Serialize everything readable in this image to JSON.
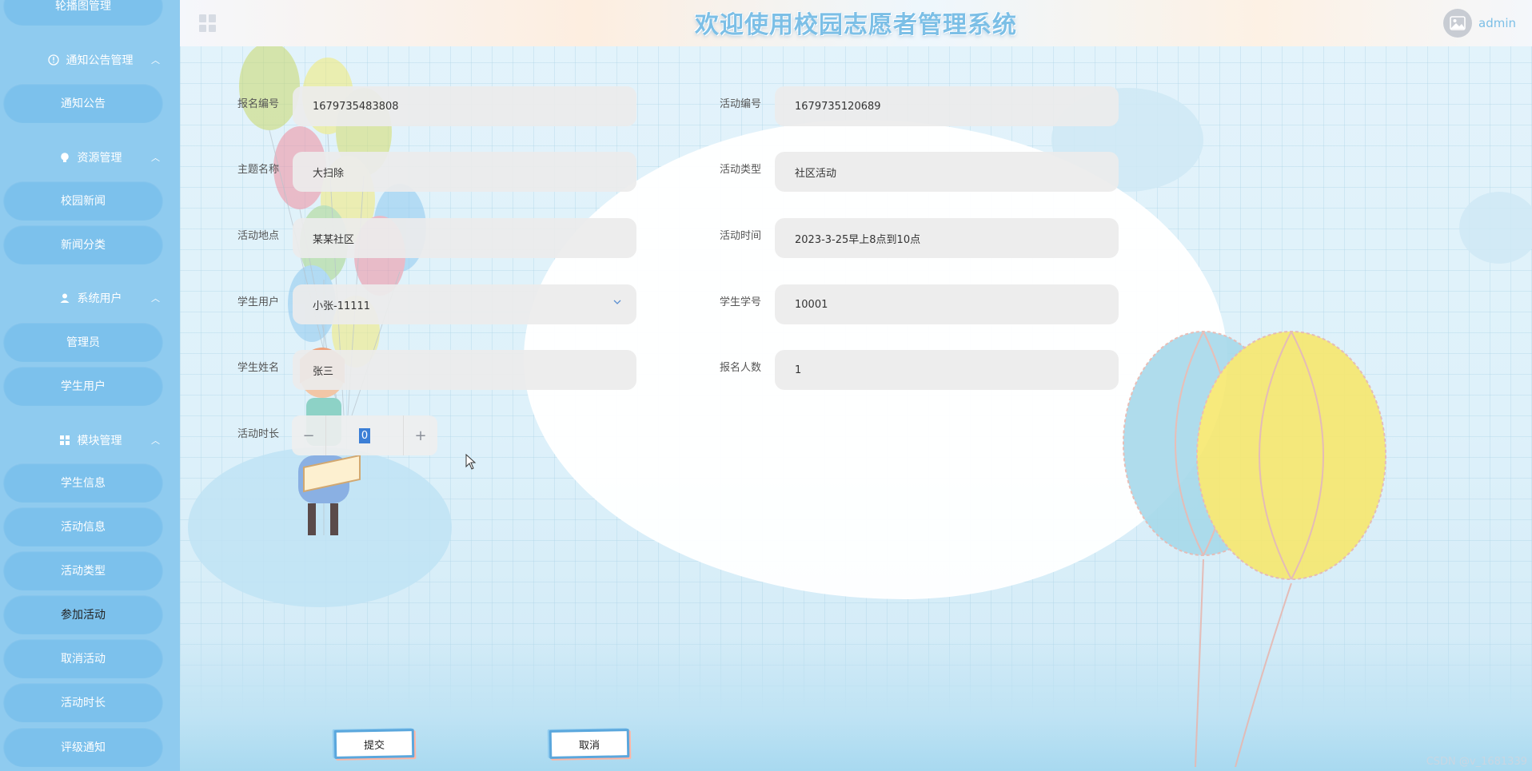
{
  "app": {
    "title": "欢迎使用校园志愿者管理系统",
    "user": "admin"
  },
  "sidebar": {
    "top_partial_item": "轮播图管理",
    "groups": [
      {
        "label": "通知公告管理",
        "icon": "info-icon",
        "items": [
          "通知公告"
        ]
      },
      {
        "label": "资源管理",
        "icon": "bulb-icon",
        "items": [
          "校园新闻",
          "新闻分类"
        ]
      },
      {
        "label": "系统用户",
        "icon": "user-icon",
        "items": [
          "管理员",
          "学生用户"
        ]
      },
      {
        "label": "模块管理",
        "icon": "grid-icon",
        "items": [
          "学生信息",
          "活动信息",
          "活动类型",
          "参加活动",
          "取消活动",
          "活动时长",
          "评级通知"
        ]
      }
    ],
    "active_item": "参加活动"
  },
  "form": {
    "registration_no": {
      "label": "报名编号",
      "value": "1679735483808"
    },
    "activity_no": {
      "label": "活动编号",
      "value": "1679735120689"
    },
    "topic_name": {
      "label": "主题名称",
      "value": "大扫除"
    },
    "activity_type": {
      "label": "活动类型",
      "value": "社区活动"
    },
    "activity_location": {
      "label": "活动地点",
      "value": "某某社区"
    },
    "activity_time": {
      "label": "活动时间",
      "value": "2023-3-25早上8点到10点"
    },
    "student_user": {
      "label": "学生用户",
      "value": "小张-11111"
    },
    "student_id": {
      "label": "学生学号",
      "value": "10001"
    },
    "student_name": {
      "label": "学生姓名",
      "value": "张三"
    },
    "participant_count": {
      "label": "报名人数",
      "value": "1"
    },
    "activity_duration": {
      "label": "活动时长",
      "value": "0",
      "minus": "−",
      "plus": "+"
    }
  },
  "actions": {
    "submit": "提交",
    "cancel": "取消"
  },
  "watermark": "CSDN @v_1681339",
  "colors": {
    "sidebar_bg": "#8fcbef",
    "pill_bg": "#7cc1ec",
    "title_color": "#7cbfe6",
    "field_bg": "#ececec"
  }
}
